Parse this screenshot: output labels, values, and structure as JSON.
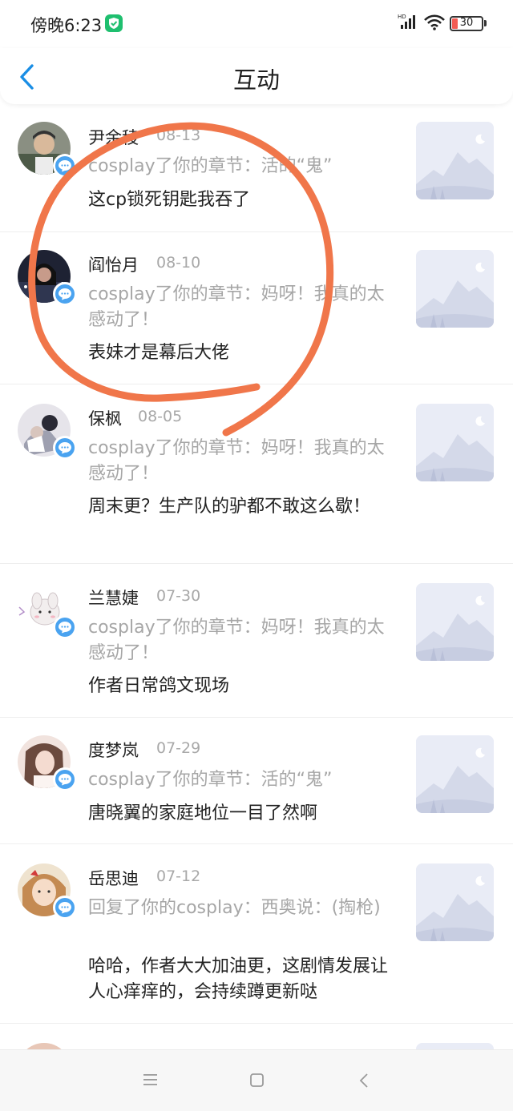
{
  "status": {
    "time": "傍晚6:23",
    "network_label": "HD",
    "battery": "30"
  },
  "header": {
    "title": "互动"
  },
  "icons": {
    "back": "chevron-left-icon",
    "badge": "comment-bubble-icon",
    "thumbnail": "placeholder-image-icon",
    "menu": "menu-icon",
    "home": "square-home-icon",
    "nav_back": "triangle-back-icon"
  },
  "colors": {
    "accent": "#1a8ee5",
    "badge": "#4aa3f0",
    "annotation": "#f0764a"
  },
  "items": [
    {
      "name": "尹余稜",
      "date": "08-13",
      "context": "cosplay了你的章节：活的“鬼”",
      "comment": "这cp锁死钥匙我吞了"
    },
    {
      "name": "阎怡月",
      "date": "08-10",
      "context": "cosplay了你的章节：妈呀！我真的太感动了！",
      "comment": "表妹才是幕后大佬"
    },
    {
      "name": "保枫",
      "date": "08-05",
      "context": "cosplay了你的章节：妈呀！我真的太感动了！",
      "comment": "周末更？生产队的驴都不敢这么歇！"
    },
    {
      "name": "兰慧婕",
      "date": "07-30",
      "context": "cosplay了你的章节：妈呀！我真的太感动了！",
      "comment": "作者日常鸽文现场"
    },
    {
      "name": "度梦岚",
      "date": "07-29",
      "context": "cosplay了你的章节：活的“鬼”",
      "comment": "唐晓翼的家庭地位一目了然啊"
    },
    {
      "name": "岳思迪",
      "date": "07-12",
      "context": "回复了你的cosplay：西奥说：(掏枪)",
      "comment": "哈哈，作者大大加油更，这剧情发展让人心痒痒的，会持续蹲更新哒"
    }
  ]
}
